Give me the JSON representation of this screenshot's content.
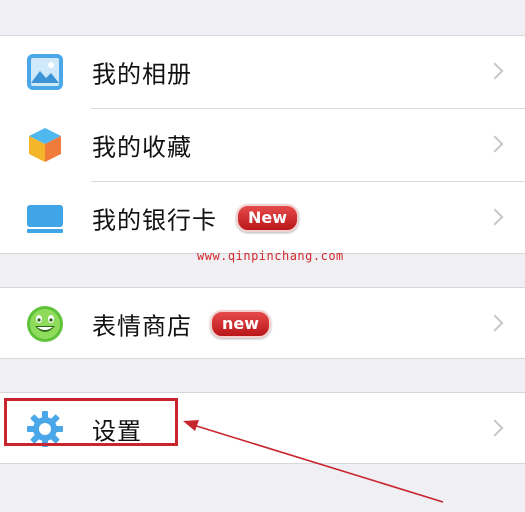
{
  "menu": {
    "items": [
      {
        "label": "我的相册",
        "icon": "photo-album-icon"
      },
      {
        "label": "我的收藏",
        "icon": "favorites-cube-icon"
      },
      {
        "label": "我的银行卡",
        "icon": "bank-card-icon",
        "badge": "New"
      },
      {
        "label": "表情商店",
        "icon": "smiley-face-icon",
        "badge": "new"
      },
      {
        "label": "设置",
        "icon": "gear-icon"
      }
    ]
  },
  "watermark": "www.qinpinchang.com",
  "colors": {
    "background": "#efeff4",
    "badge": "#c8252f",
    "highlight": "#c8252f",
    "watermark": "#d22a2a"
  }
}
